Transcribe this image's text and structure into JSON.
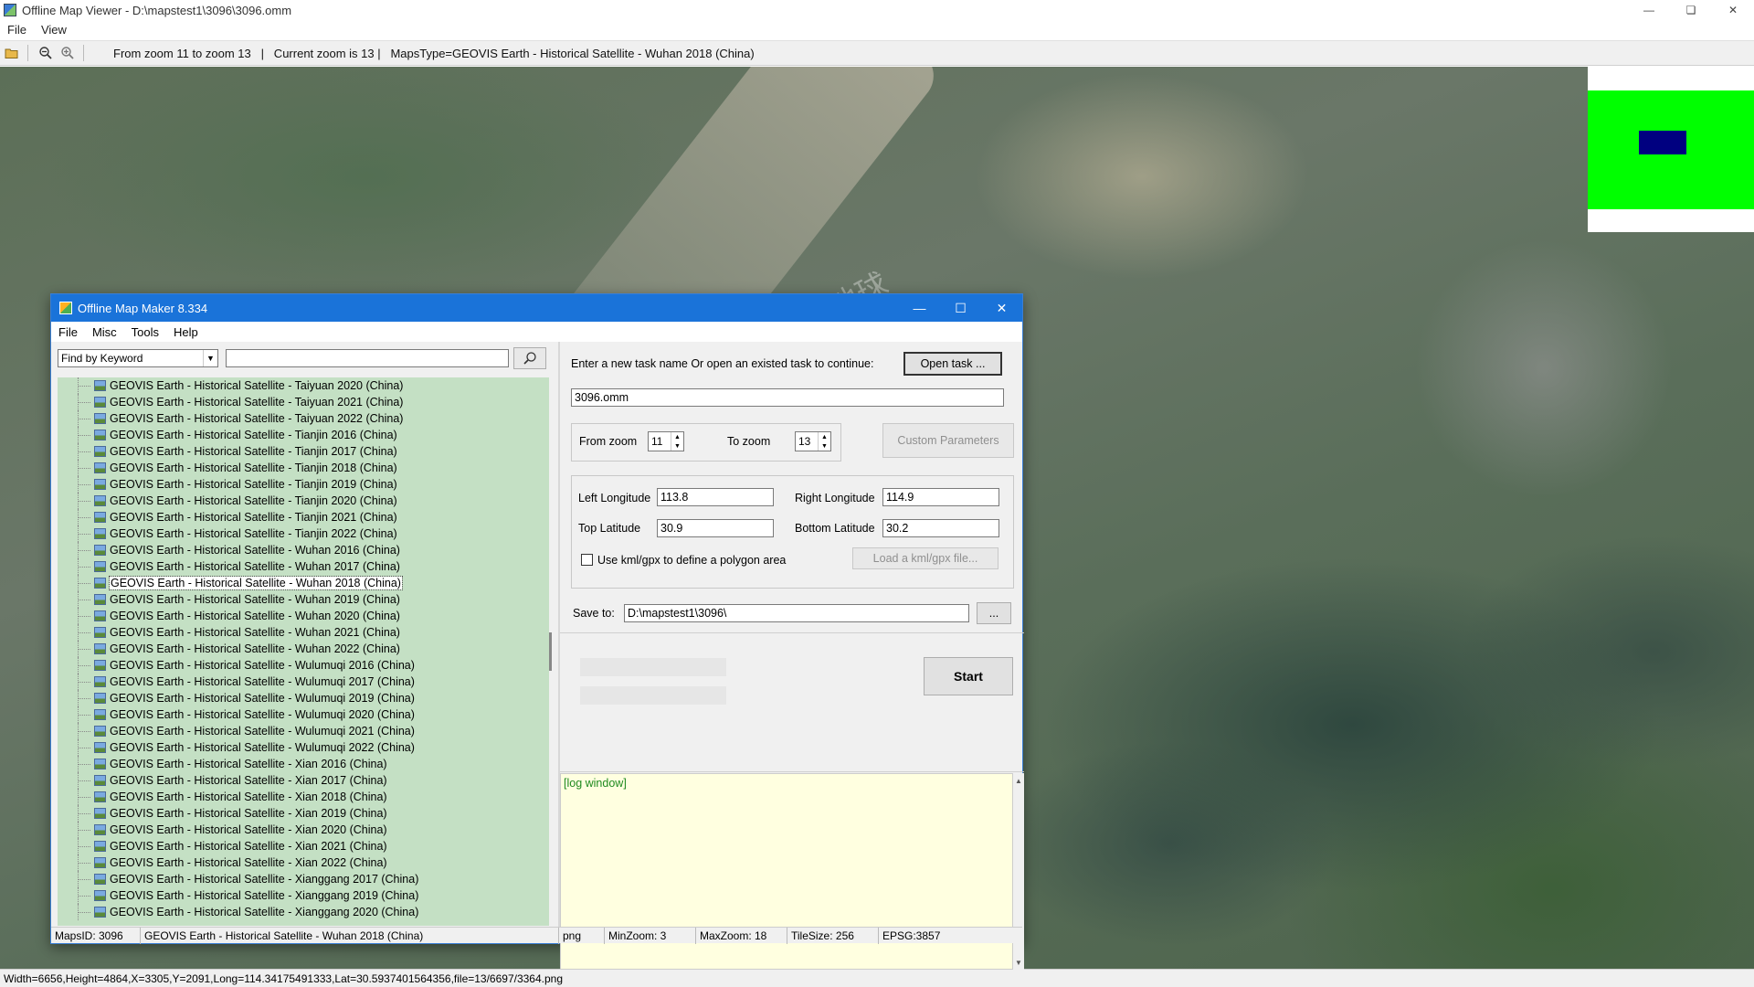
{
  "viewer": {
    "title": "Offline Map Viewer - D:\\mapstest1\\3096\\3096.omm",
    "menu": [
      "File",
      "View"
    ],
    "toolbar_info": "From zoom 11 to zoom 13   |   Current zoom is 13 |   MapsType=GEOVIS Earth - Historical Satellite - Wuhan 2018 (China)",
    "status": "Width=6656,Height=4864,X=3305,Y=2091,Long=114.34175491333,Lat=30.5937401564356,file=13/6697/3364.png",
    "watermark": "星图地球",
    "icons": [
      "open-folder-icon",
      "zoom-out-icon",
      "zoom-in-icon",
      "minimize-icon",
      "maximize-icon",
      "close-icon"
    ]
  },
  "maker": {
    "title": "Offline Map Maker 8.334",
    "menu": [
      "File",
      "Misc",
      "Tools",
      "Help"
    ],
    "find_mode": "Find by Keyword",
    "search_value": "",
    "maps_list": [
      "GEOVIS Earth - Historical Satellite - Taiyuan 2020 (China)",
      "GEOVIS Earth - Historical Satellite - Taiyuan 2021 (China)",
      "GEOVIS Earth - Historical Satellite - Taiyuan 2022 (China)",
      "GEOVIS Earth - Historical Satellite - Tianjin 2016 (China)",
      "GEOVIS Earth - Historical Satellite - Tianjin 2017 (China)",
      "GEOVIS Earth - Historical Satellite - Tianjin 2018 (China)",
      "GEOVIS Earth - Historical Satellite - Tianjin 2019 (China)",
      "GEOVIS Earth - Historical Satellite - Tianjin 2020 (China)",
      "GEOVIS Earth - Historical Satellite - Tianjin 2021 (China)",
      "GEOVIS Earth - Historical Satellite - Tianjin 2022 (China)",
      "GEOVIS Earth - Historical Satellite - Wuhan 2016 (China)",
      "GEOVIS Earth - Historical Satellite - Wuhan 2017 (China)",
      "GEOVIS Earth - Historical Satellite - Wuhan 2018 (China)",
      "GEOVIS Earth - Historical Satellite - Wuhan 2019 (China)",
      "GEOVIS Earth - Historical Satellite - Wuhan 2020 (China)",
      "GEOVIS Earth - Historical Satellite - Wuhan 2021 (China)",
      "GEOVIS Earth - Historical Satellite - Wuhan 2022 (China)",
      "GEOVIS Earth - Historical Satellite - Wulumuqi 2016 (China)",
      "GEOVIS Earth - Historical Satellite - Wulumuqi 2017 (China)",
      "GEOVIS Earth - Historical Satellite - Wulumuqi 2019 (China)",
      "GEOVIS Earth - Historical Satellite - Wulumuqi 2020 (China)",
      "GEOVIS Earth - Historical Satellite - Wulumuqi 2021 (China)",
      "GEOVIS Earth - Historical Satellite - Wulumuqi 2022 (China)",
      "GEOVIS Earth - Historical Satellite - Xian 2016 (China)",
      "GEOVIS Earth - Historical Satellite - Xian 2017 (China)",
      "GEOVIS Earth - Historical Satellite - Xian 2018 (China)",
      "GEOVIS Earth - Historical Satellite - Xian 2019 (China)",
      "GEOVIS Earth - Historical Satellite - Xian 2020 (China)",
      "GEOVIS Earth - Historical Satellite - Xian 2021 (China)",
      "GEOVIS Earth - Historical Satellite - Xian 2022 (China)",
      "GEOVIS Earth - Historical Satellite - Xianggang 2017 (China)",
      "GEOVIS Earth - Historical Satellite - Xianggang 2019 (China)",
      "GEOVIS Earth - Historical Satellite - Xianggang 2020 (China)"
    ],
    "selected_map": "GEOVIS Earth - Historical Satellite - Wuhan 2018 (China)",
    "task_prompt": "Enter a new task name Or open an existed task to continue:",
    "open_task_label": "Open task ...",
    "task_name": "3096.omm",
    "from_zoom_label": "From zoom",
    "from_zoom": "11",
    "to_zoom_label": "To zoom",
    "to_zoom": "13",
    "custom_params_label": "Custom Parameters",
    "left_lon_label": "Left Longitude",
    "left_lon": "113.8",
    "right_lon_label": "Right Longitude",
    "right_lon": "114.9",
    "top_lat_label": "Top Latitude",
    "top_lat": "30.9",
    "bottom_lat_label": "Bottom Latitude",
    "bottom_lat": "30.2",
    "use_kml_label": "Use kml/gpx to define a polygon area",
    "use_kml_checked": false,
    "load_kml_label": "Load a kml/gpx file...",
    "save_to_label": "Save to:",
    "save_to": "D:\\mapstest1\\3096\\",
    "browse_label": "...",
    "start_label": "Start",
    "progress1": 0,
    "progress2": 0,
    "log_text": "[log window]",
    "status": {
      "maps_id": "MapsID: 3096",
      "maps_name": "GEOVIS Earth - Historical Satellite - Wuhan 2018 (China)",
      "format": "png",
      "min_zoom": "MinZoom: 3",
      "max_zoom": "MaxZoom: 18",
      "tile_size": "TileSize: 256",
      "epsg": "EPSG:3857"
    }
  },
  "colors": {
    "maker_titlebar": "#1a73d9",
    "list_background": "#c4e0c4",
    "log_background": "#ffffe0",
    "log_text": "#1f8a1f",
    "overview_green": "#00ff00",
    "overview_box": "#000080"
  }
}
